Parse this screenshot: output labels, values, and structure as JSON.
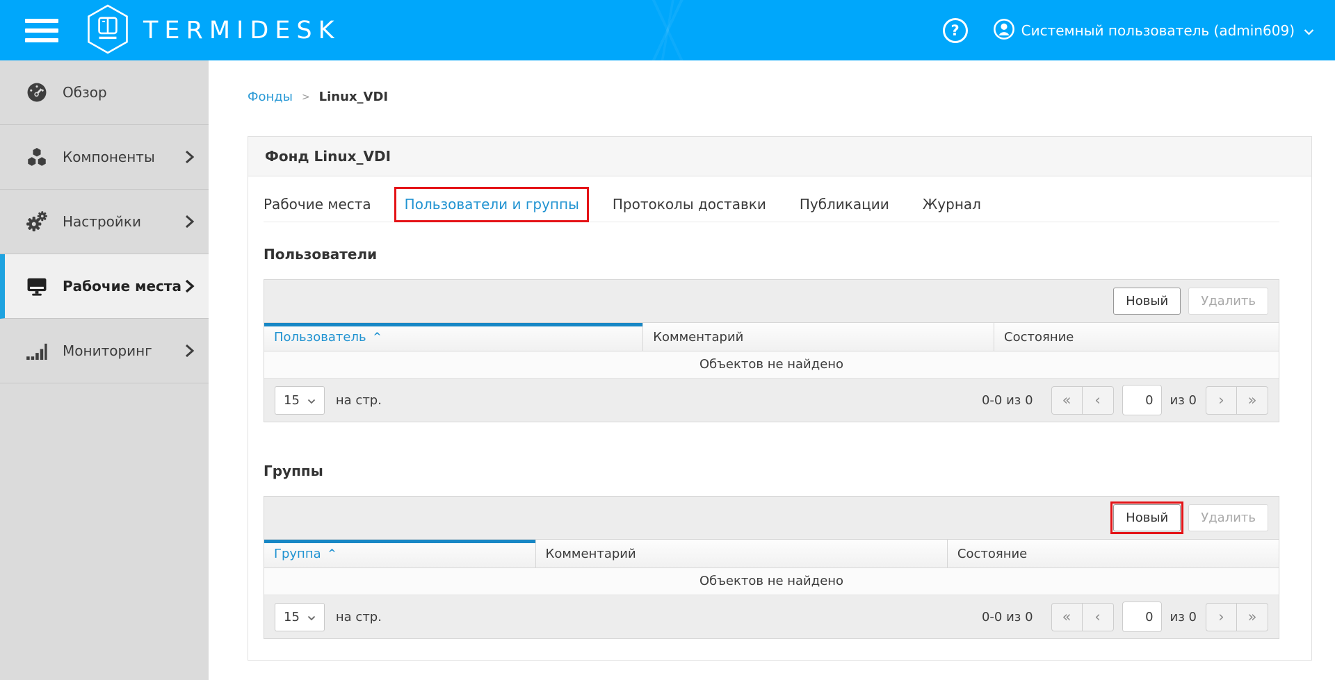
{
  "colors": {
    "header_bg": "#00a7fb",
    "accent_blue": "#2193d1",
    "sort_bar_blue": "#1787c5",
    "annotation_red": "#e41317",
    "sidebar_bg": "#dbdbdb"
  },
  "header": {
    "brand": "TERMIDESK",
    "help_label": "?",
    "user_label": "Системный пользователь (admin609)"
  },
  "sidebar": {
    "items": [
      {
        "label": "Обзор",
        "icon": "dashboard-icon",
        "has_submenu": false,
        "active": false
      },
      {
        "label": "Компоненты",
        "icon": "cubes-icon",
        "has_submenu": true,
        "active": false
      },
      {
        "label": "Настройки",
        "icon": "gears-icon",
        "has_submenu": true,
        "active": false
      },
      {
        "label": "Рабочие места",
        "icon": "monitor-icon",
        "has_submenu": true,
        "active": true
      },
      {
        "label": "Мониторинг",
        "icon": "chart-bars-icon",
        "has_submenu": true,
        "active": false
      }
    ]
  },
  "breadcrumb": {
    "parent": "Фонды",
    "separator": ">",
    "current": "Linux_VDI"
  },
  "card": {
    "title": "Фонд Linux_VDI"
  },
  "tabs": {
    "active_index": 1,
    "items": [
      {
        "label": "Рабочие места"
      },
      {
        "label": "Пользователи и группы"
      },
      {
        "label": "Протоколы доставки"
      },
      {
        "label": "Публикации"
      },
      {
        "label": "Журнал"
      }
    ]
  },
  "users_section": {
    "title": "Пользователи",
    "buttons": {
      "new": "Новый",
      "delete": "Удалить"
    },
    "columns": [
      {
        "label": "Пользователь",
        "sort": "^"
      },
      {
        "label": "Комментарий"
      },
      {
        "label": "Состояние"
      }
    ],
    "empty_text": "Объектов не найдено",
    "pagination": {
      "per_page": "15",
      "per_page_label": "на стр.",
      "range": "0-0 из 0",
      "first": "«",
      "prev": "‹",
      "page": "0",
      "of_label": "из 0",
      "next": "›",
      "last": "»"
    }
  },
  "groups_section": {
    "title": "Группы",
    "buttons": {
      "new": "Новый",
      "delete": "Удалить"
    },
    "columns": [
      {
        "label": "Группа",
        "sort": "^"
      },
      {
        "label": "Комментарий"
      },
      {
        "label": "Состояние"
      }
    ],
    "empty_text": "Объектов не найдено",
    "pagination": {
      "per_page": "15",
      "per_page_label": "на стр.",
      "range": "0-0 из 0",
      "first": "«",
      "prev": "‹",
      "page": "0",
      "of_label": "из 0",
      "next": "›",
      "last": "»"
    }
  }
}
